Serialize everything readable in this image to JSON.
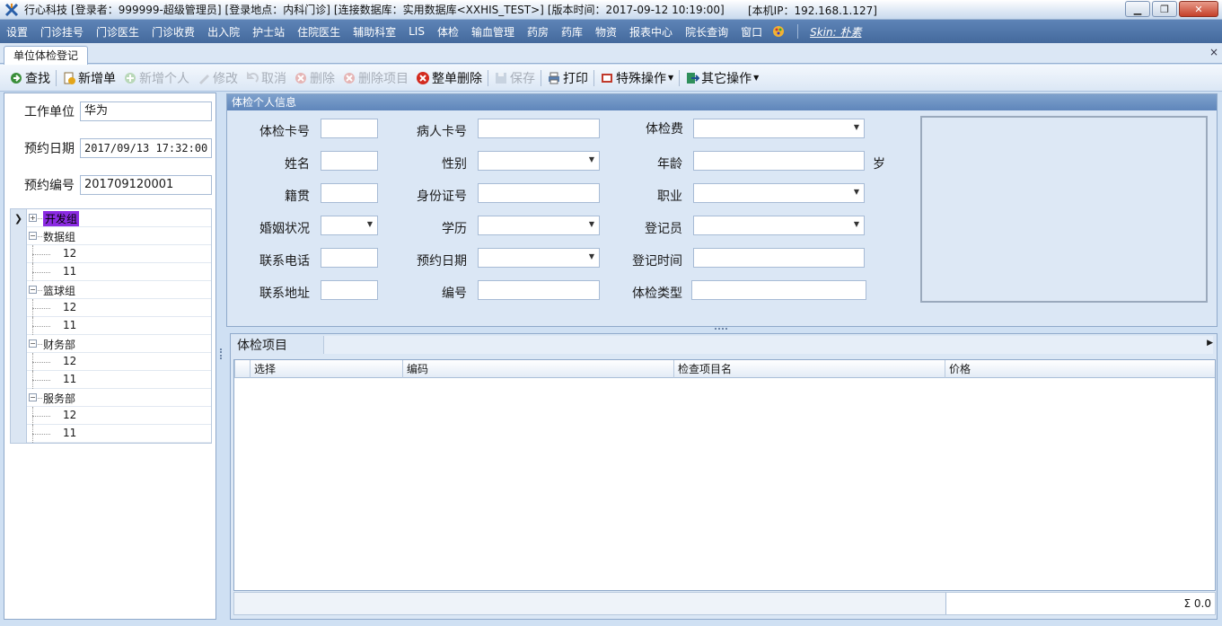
{
  "title": {
    "app_name": "行心科技",
    "login_user": "[登录者：999999-超级管理员]",
    "login_location": "[登录地点：内科门诊]",
    "database": "[连接数据库：实用数据库<XXHIS_TEST>]",
    "version": "[版本时间：2017-09-12 10:19:00]",
    "local_ip": "[本机IP：192.168.1.127]"
  },
  "menu": [
    "设置",
    "门诊挂号",
    "门诊医生",
    "门诊收费",
    "出入院",
    "护士站",
    "住院医生",
    "辅助科室",
    "LIS",
    "体检",
    "输血管理",
    "药房",
    "药库",
    "物资",
    "报表中心",
    "院长查询",
    "窗口"
  ],
  "skin_label": "Skin: 朴素",
  "tab": {
    "label": "单位体检登记",
    "close": "×"
  },
  "toolbar": {
    "find": "查找",
    "new_order": "新增单",
    "new_person": "新增个人",
    "modify": "修改",
    "cancel": "取消",
    "delete": "删除",
    "delete_item": "删除项目",
    "delete_order": "整单删除",
    "save": "保存",
    "print": "打印",
    "special": "特殊操作",
    "other": "其它操作"
  },
  "left": {
    "work_unit_label": "工作单位",
    "work_unit_value": "华为",
    "appt_date_label": "预约日期",
    "appt_date_value": "2017/09/13 17:32:00",
    "appt_no_label": "预约编号",
    "appt_no_value": "201709120001",
    "tree": [
      {
        "label": "开发组",
        "level": 0,
        "selected": true
      },
      {
        "label": "数据组",
        "level": 0
      },
      {
        "label": "12",
        "level": 1
      },
      {
        "label": "11",
        "level": 1
      },
      {
        "label": "篮球组",
        "level": 0
      },
      {
        "label": "12",
        "level": 1
      },
      {
        "label": "11",
        "level": 1
      },
      {
        "label": "财务部",
        "level": 0
      },
      {
        "label": "12",
        "level": 1
      },
      {
        "label": "11",
        "level": 1
      },
      {
        "label": "服务部",
        "level": 0
      },
      {
        "label": "12",
        "level": 1
      },
      {
        "label": "11",
        "level": 1
      }
    ]
  },
  "info": {
    "group_title": "体检个人信息",
    "card_no": "体检卡号",
    "patient_card": "病人卡号",
    "fee": "体检费",
    "name": "姓名",
    "gender": "性别",
    "age": "年龄",
    "age_unit": "岁",
    "origin": "籍贯",
    "id_no": "身份证号",
    "job": "职业",
    "marital": "婚姻状况",
    "education": "学历",
    "registrar": "登记员",
    "phone": "联系电话",
    "appt_date": "预约日期",
    "reg_time": "登记时间",
    "address": "联系地址",
    "number": "编号",
    "exam_type": "体检类型"
  },
  "items": {
    "title": "体检项目",
    "columns": [
      "选择",
      "编码",
      "检查项目名",
      "价格"
    ],
    "sum": "Σ 0.0"
  },
  "colors": {
    "menubar": "#4f75a8",
    "selected": "#8b2be2",
    "panel": "#dbe7f5"
  }
}
